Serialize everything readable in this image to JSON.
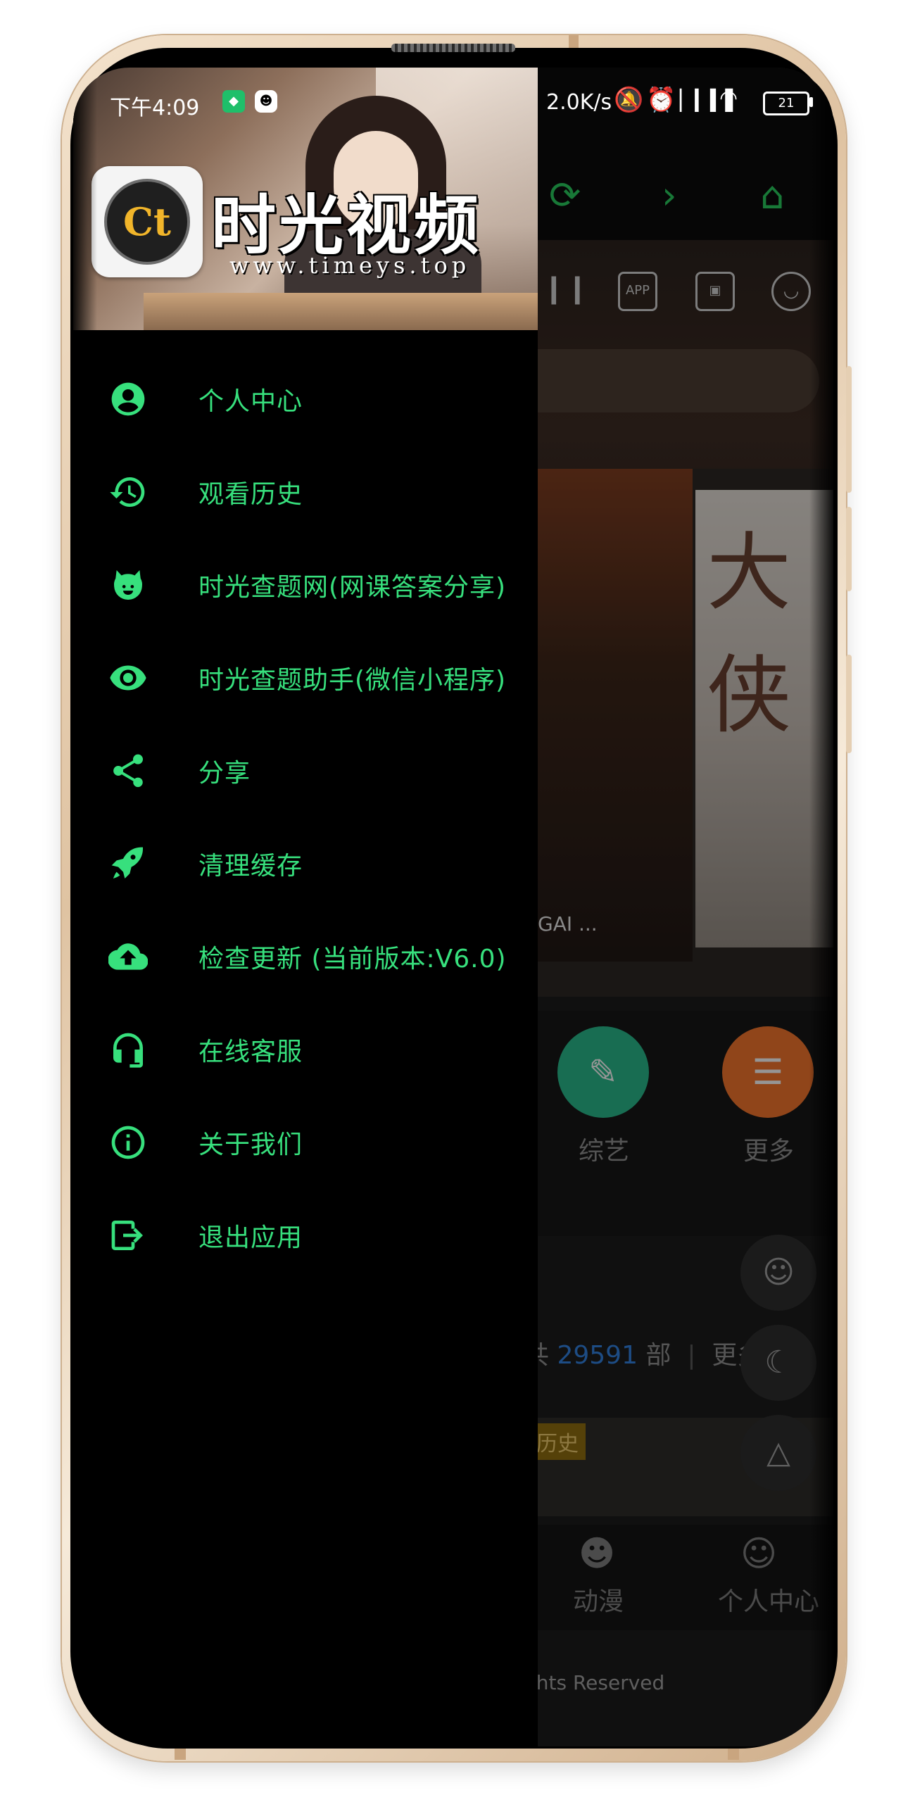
{
  "status_bar": {
    "time": "下午4:09",
    "network_speed": "2.0K/s",
    "battery_level": "21"
  },
  "drawer": {
    "brand_title": "时光视频",
    "brand_url": "www.timeys.top",
    "logo_text": "Ct",
    "menu_items": [
      {
        "label": "个人中心",
        "icon": "account-circle-icon"
      },
      {
        "label": "观看历史",
        "icon": "history-icon"
      },
      {
        "label": "时光查题网(网课答案分享)",
        "icon": "pig-icon"
      },
      {
        "label": "时光查题助手(微信小程序)",
        "icon": "eye-icon"
      },
      {
        "label": "分享",
        "icon": "share-icon"
      },
      {
        "label": "清理缓存",
        "icon": "rocket-icon"
      },
      {
        "label": "检查更新 (当前版本:V6.0)",
        "icon": "cloud-upload-icon"
      },
      {
        "label": "在线客服",
        "icon": "headset-icon"
      },
      {
        "label": "关于我们",
        "icon": "info-icon"
      },
      {
        "label": "退出应用",
        "icon": "logout-icon"
      }
    ]
  },
  "background_app": {
    "poster_caption": "GAI ...",
    "poster_title": "大侠",
    "categories": [
      {
        "label": "综艺",
        "color": "#27b085"
      },
      {
        "label": "更多",
        "color": "#e8702a"
      }
    ],
    "count_prefix": "共",
    "count_value": "29591",
    "count_suffix": "部",
    "more_link": "更多 >",
    "history_tag": "历史",
    "bottom_nav": [
      "动漫",
      "个人中心"
    ],
    "footer_text": "ghts Reserved"
  },
  "colors": {
    "accent_green": "#37e07d",
    "count_blue": "#2f7bd6"
  }
}
